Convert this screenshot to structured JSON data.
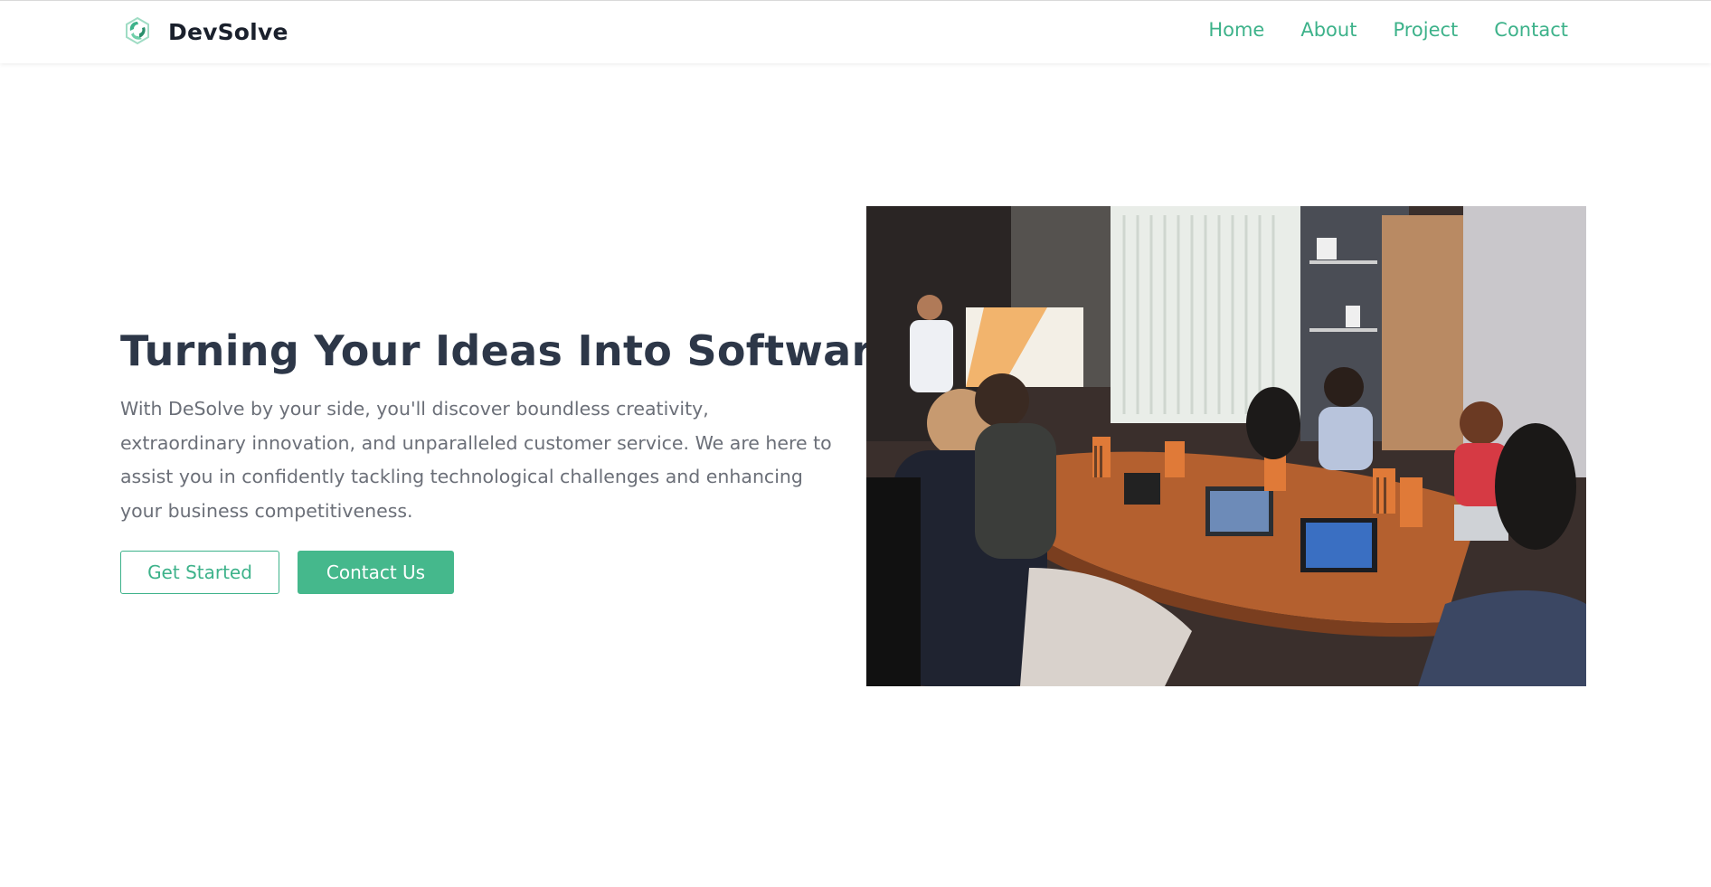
{
  "header": {
    "brand_name": "DevSolve",
    "logo_icon": "hexagon-swirl-logo",
    "nav": [
      {
        "label": "Home"
      },
      {
        "label": "About"
      },
      {
        "label": "Project"
      },
      {
        "label": "Contact"
      }
    ]
  },
  "hero": {
    "title": "Turning Your Ideas Into Software",
    "description": "With DeSolve by your side, you'll discover boundless creativity, extraordinary innovation, and unparalleled customer service. We are here to assist you in confidently tackling technological challenges and enhancing your business competitiveness.",
    "primary_button": "Get Started",
    "secondary_button": "Contact Us",
    "image_subject": "team meeting around conference table with presenter"
  },
  "colors": {
    "accent": "#3db28a",
    "button_fill": "#45b88c",
    "title_text": "#2d3748",
    "body_text": "#6b6f78",
    "brand_text": "#1a202c"
  }
}
